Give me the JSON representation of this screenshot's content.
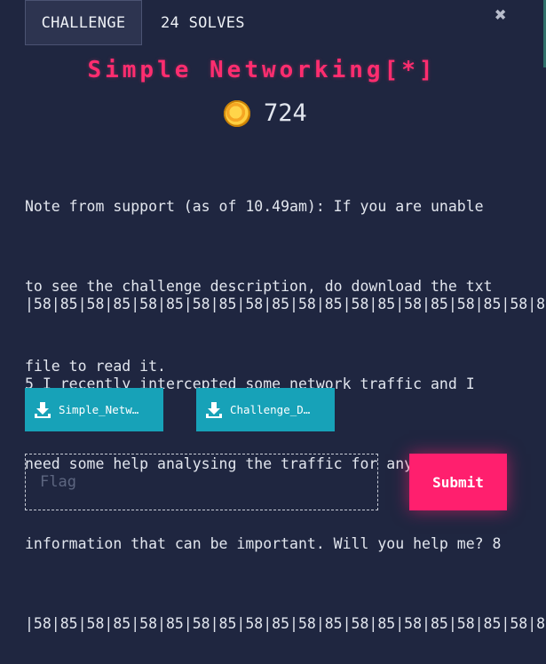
{
  "tabs": [
    {
      "label": "CHALLENGE",
      "active": true
    },
    {
      "label": "24 SOLVES",
      "active": false
    }
  ],
  "close_icon": "close-icon",
  "challenge": {
    "title": "Simple Networking[*]",
    "points": "724",
    "points_icon": "coin-icon",
    "note_lines": [
      "Note from support (as of 10.49am): If you are unable",
      "to see the challenge description, do download the txt",
      "file to read it."
    ],
    "description_lines": [
      "|58|85|58|85|58|85|58|85|58|85|58|85|58|85|58|85|58|85|58|85|58|8",
      "5 I recently intercepted some network traffic and I",
      "need some help analysing the traffic for any juicy",
      "information that can be important. Will you help me? 8",
      "|58|85|58|85|58|85|58|85|58|85|58|85|58|85|58|85|58|85|58|85|58|8"
    ]
  },
  "downloads": [
    {
      "label": "Simple_Netw…",
      "icon": "download-icon"
    },
    {
      "label": "Challenge_D…",
      "icon": "download-icon"
    }
  ],
  "flag": {
    "placeholder": "Flag",
    "value": ""
  },
  "submit_label": "Submit",
  "colors": {
    "background": "#1f2640",
    "title": "#ff2d6f",
    "download_button": "#17a2b8",
    "submit_button": "#ff1f6e"
  }
}
